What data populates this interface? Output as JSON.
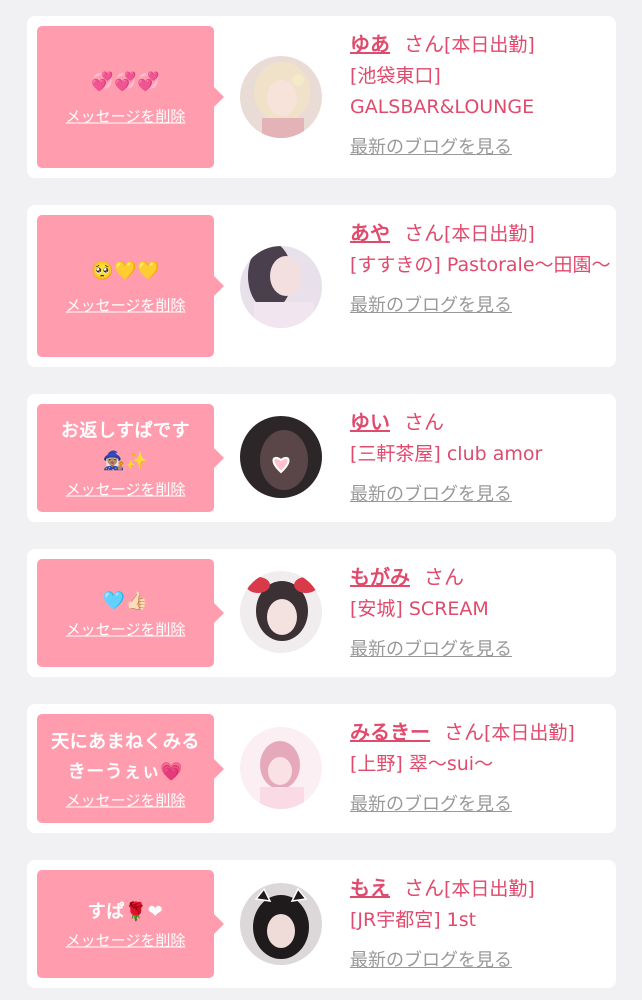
{
  "delete_label": "メッセージを削除",
  "blog_label": "最新のブログを見る",
  "san_label": "さん",
  "colors": {
    "bubble": "#ff9daf",
    "accent_text": "#e04a6d",
    "muted_link": "#999999",
    "card_bg": "#ffffff",
    "page_bg": "#f1f1f3"
  },
  "messages": [
    {
      "message": "💞💞💞",
      "name": "ゆあ",
      "status": "[本日出勤]",
      "shop": "[池袋東口] GALSBAR&LOUNGE",
      "avatar": "photo-blonde-woman"
    },
    {
      "message": "🥺💛💛",
      "name": "あや",
      "status": "[本日出勤]",
      "shop": "[すすきの] Pastorale〜田園〜",
      "avatar": "photo-dark-hair-woman"
    },
    {
      "message": "お返しすぱです🧙🏽‍♀️✨",
      "name": "ゆい",
      "status": "",
      "shop": "[三軒茶屋] club amor",
      "avatar": "photo-heart-covered-face"
    },
    {
      "message": "🩵👍🏻",
      "name": "もがみ",
      "status": "",
      "shop": "[安城] SCREAM",
      "avatar": "photo-red-bow"
    },
    {
      "message": "天にあまねくみるきーうぇぃ💗",
      "name": "みるきー",
      "status": "[本日出勤]",
      "shop": "[上野] 翠〜sui〜",
      "avatar": "photo-pink-room"
    },
    {
      "message": "すぱ🌹❤",
      "name": "もえ",
      "status": "[本日出勤]",
      "shop": "[JR宇都宮] 1st",
      "avatar": "photo-cat-ears"
    }
  ]
}
